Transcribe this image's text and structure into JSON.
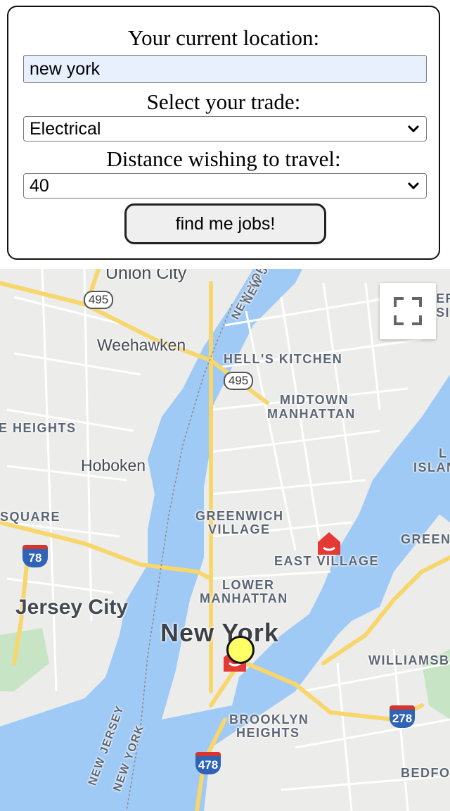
{
  "form": {
    "location_label": "Your current location:",
    "location_value": "new york",
    "trade_label": "Select your trade:",
    "trade_value": "Electrical",
    "distance_label": "Distance wishing to travel:",
    "distance_value": "40",
    "submit_label": "find me jobs!"
  },
  "map": {
    "labels": {
      "union_city": "Union City",
      "weehawken": "Weehawken",
      "hells_kitchen": "HELL'S KITCHEN",
      "midtown": "MIDTOWN",
      "manhattan": "MANHATTAN",
      "heights": "E HEIGHTS",
      "hoboken": "Hoboken",
      "square": "SQUARE",
      "greenwich": "GREENWICH",
      "village": "VILLAGE",
      "east_village": "EAST VILLAGE",
      "lower": "LOWER",
      "lower_manhattan": "MANHATTAN",
      "jersey_city": "Jersey City",
      "new_york": "New York",
      "williamsburg": "WILLIAMSB",
      "brooklyn": "BROOKLYN",
      "brooklyn_heights": "HEIGHTS",
      "bedford": "BEDFO",
      "green": "GREEN",
      "isl": "ISLAN",
      "er": "ER",
      "si": "SI",
      "l": "L",
      "river_new_york_top": "NEW YORK",
      "river_new_jersey": "NEW JERSEY",
      "river_new_york": "NEW YORK",
      "river_new_j_top": "NEW J"
    },
    "shields": {
      "r495a": "495",
      "r495b": "495",
      "r78": "78",
      "r278": "278",
      "r478": "478"
    },
    "icons": [
      "fullscreen-icon",
      "job-marker-icon",
      "current-location-marker"
    ],
    "colors": {
      "water": "#9fcaf5",
      "land": "#ececea",
      "highway": "#f7d66b",
      "marker": "#e53935",
      "location": "#ffff66"
    }
  }
}
